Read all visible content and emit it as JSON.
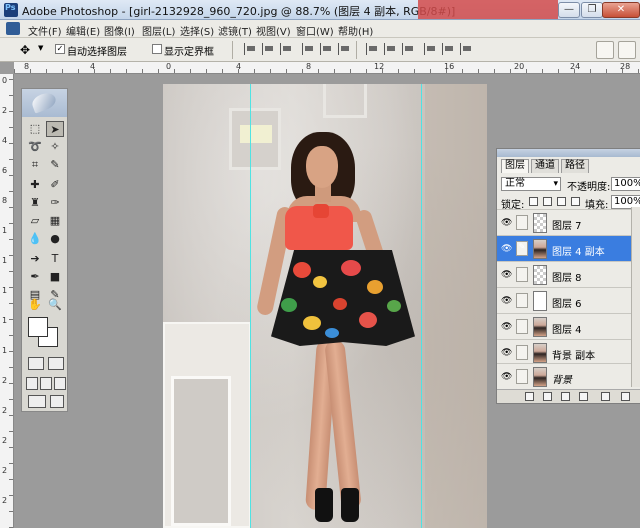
{
  "window": {
    "title": "Adobe Photoshop - [girl-2132928_960_720.jpg @ 88.7% (图层 4 副本, RGB/8#)]",
    "minimize": "—",
    "restore": "❐",
    "close": "✕"
  },
  "menu": [
    "文件(F)",
    "编辑(E)",
    "图像(I)",
    "图层(L)",
    "选择(S)",
    "滤镜(T)",
    "视图(V)",
    "窗口(W)",
    "帮助(H)"
  ],
  "options": {
    "auto_select_label": "自动选择图层",
    "auto_select_checked": true,
    "show_bounds_label": "显示定界框",
    "show_bounds_checked": false
  },
  "rulers": {
    "h_labels": [
      "8",
      "4",
      "0",
      "4",
      "8",
      "12",
      "16",
      "20",
      "24",
      "28"
    ],
    "v_labels": [
      "0",
      "2",
      "4",
      "6",
      "8",
      "1",
      "1",
      "1",
      "1",
      "1",
      "2",
      "2",
      "2",
      "2",
      "2"
    ]
  },
  "layers_panel": {
    "tabs": [
      "图层",
      "通道",
      "路径"
    ],
    "blend_mode": "正常",
    "opacity_label": "不透明度:",
    "opacity_value": "100%",
    "lock_label": "锁定:",
    "fill_label": "填充:",
    "fill_value": "100%",
    "layers": [
      {
        "name": "图层 7",
        "thumb": "transparent",
        "active": false
      },
      {
        "name": "图层 4 副本",
        "thumb": "photo",
        "active": true
      },
      {
        "name": "图层 8",
        "thumb": "transparent",
        "active": false
      },
      {
        "name": "图层 6",
        "thumb": "white",
        "active": false
      },
      {
        "name": "图层 4",
        "thumb": "photo",
        "active": false
      },
      {
        "name": "背景 副本",
        "thumb": "photo",
        "active": false
      },
      {
        "name": "背景",
        "thumb": "photo",
        "active": false
      }
    ]
  },
  "colors": {
    "accent": "#3a7de0",
    "guide": "#4fe3e3"
  }
}
